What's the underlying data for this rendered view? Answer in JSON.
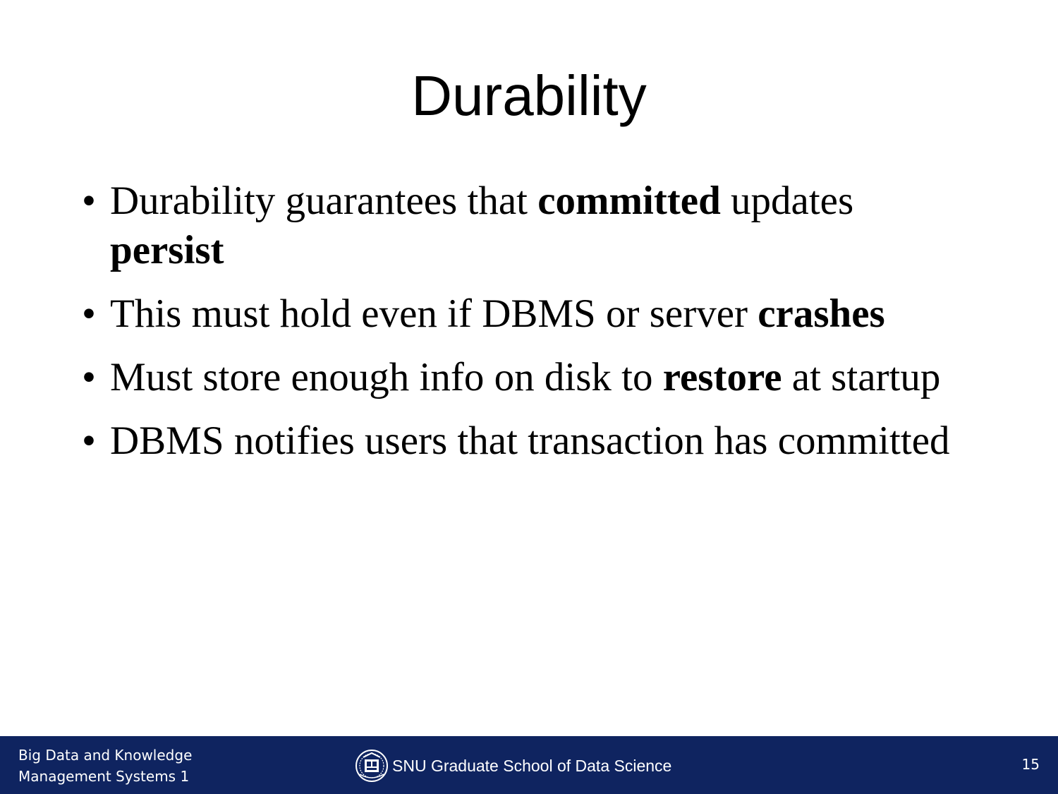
{
  "slide": {
    "title": "Durability",
    "bullets": [
      {
        "parts": [
          {
            "text": "Durability guarantees that ",
            "bold": false
          },
          {
            "text": "committed",
            "bold": true
          },
          {
            "text": " updates ",
            "bold": false
          },
          {
            "text": "persist",
            "bold": true
          }
        ]
      },
      {
        "parts": [
          {
            "text": "This must hold even if DBMS or server ",
            "bold": false
          },
          {
            "text": "crashes",
            "bold": true
          }
        ]
      },
      {
        "parts": [
          {
            "text": "Must store enough info on disk to ",
            "bold": false
          },
          {
            "text": "restore",
            "bold": true
          },
          {
            "text": " at startup",
            "bold": false
          }
        ]
      },
      {
        "parts": [
          {
            "text": "DBMS notifies users that transaction has committed",
            "bold": false
          }
        ]
      }
    ]
  },
  "footer": {
    "course_line1": "Big Data and Knowledge",
    "course_line2": "Management Systems 1",
    "school": "SNU Graduate School of Data Science",
    "logo_icon": "snu-emblem-icon",
    "page_number": "15",
    "background_color": "#0f2460"
  }
}
